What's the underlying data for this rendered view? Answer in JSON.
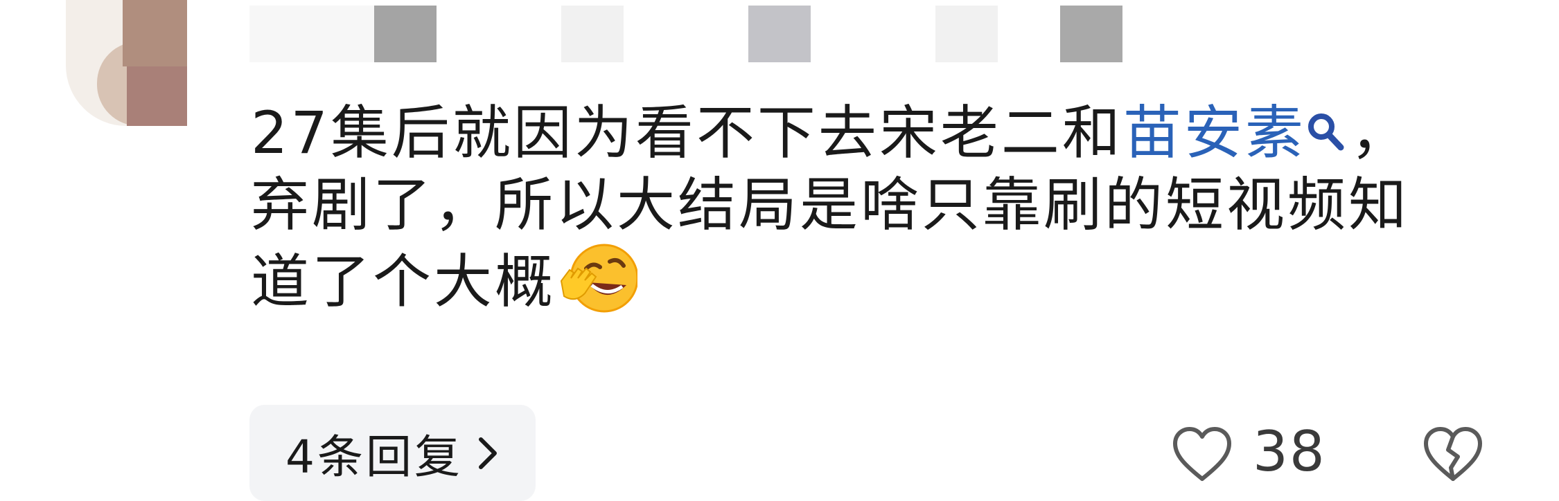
{
  "comment": {
    "text_before_link": "27集后就因为看不下去宋老二和",
    "link_text": "苗安素",
    "text_after_link": "，弃剧了，所以大结局是啥只靠刷的短视频知道了个大概",
    "link_icon": "search-icon",
    "emoji": "face-with-tears-of-joy-hand-emoji",
    "link_color": "#2a62b8"
  },
  "replies": {
    "label": "4条回复",
    "icon": "chevron-right-icon"
  },
  "actions": {
    "like_icon": "heart-outline-icon",
    "like_count": "38",
    "dislike_icon": "broken-heart-icon"
  },
  "colors": {
    "text": "#1a1a1a",
    "pill_bg": "#f3f4f6",
    "icon_gray": "#5a5a5a"
  }
}
